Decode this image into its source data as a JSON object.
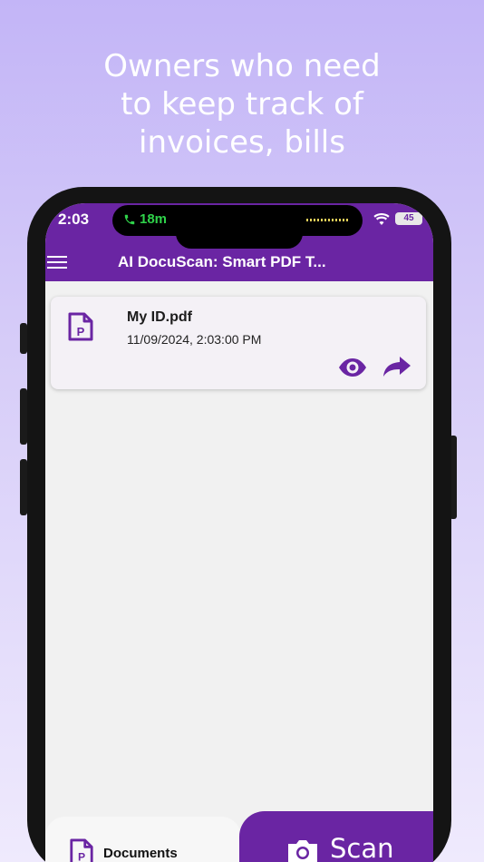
{
  "headline": [
    "Owners who need",
    "to keep track of",
    "invoices, bills"
  ],
  "status_bar": {
    "time": "2:03",
    "call_duration": "18m",
    "battery": "45"
  },
  "app_bar": {
    "title": "AI DocuScan: Smart PDF T..."
  },
  "documents": [
    {
      "name": "My ID.pdf",
      "date": "11/09/2024, 2:03:00 PM"
    }
  ],
  "bottom_nav": {
    "documents_label": "Documents",
    "scan_label": "Scan"
  },
  "colors": {
    "brand": "#6a25a3",
    "background": "#c3b5f7",
    "call_green": "#2fd24a"
  }
}
